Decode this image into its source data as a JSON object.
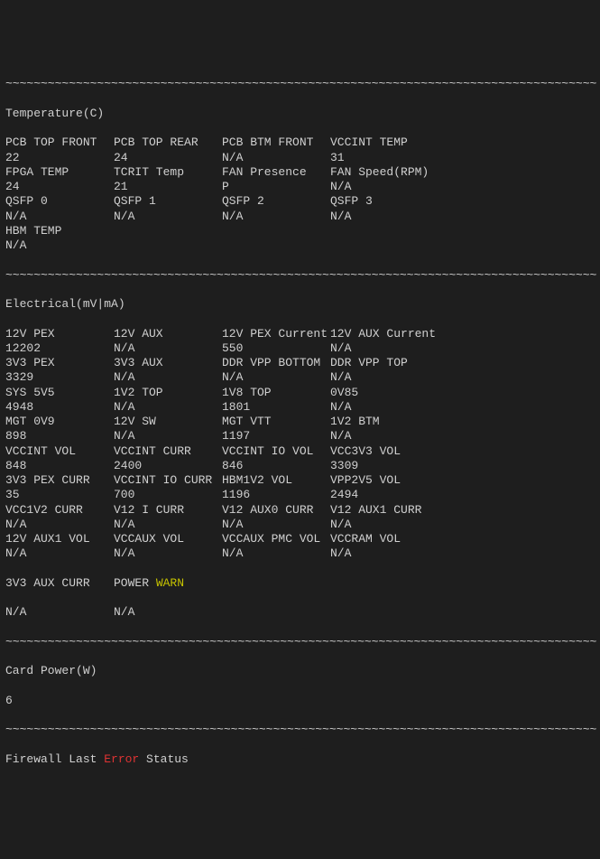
{
  "separator": "~~~~~~~~~~~~~~~~~~~~~~~~~~~~~~~~~~~~~~~~~~~~~~~~~~~~~~~~~~~~~~~~~~~~~~~~~~~~~~~~~~~~",
  "sections": {
    "temperature": {
      "title": "Temperature(C)",
      "rows": [
        [
          "PCB TOP FRONT",
          "PCB TOP REAR",
          "PCB BTM FRONT",
          "VCCINT TEMP"
        ],
        [
          "22",
          "24",
          "N/A",
          "31"
        ],
        [
          "FPGA TEMP",
          "TCRIT Temp",
          "FAN Presence",
          "FAN Speed(RPM)"
        ],
        [
          "24",
          "21",
          "P",
          "N/A"
        ],
        [
          "QSFP 0",
          "QSFP 1",
          "QSFP 2",
          "QSFP 3"
        ],
        [
          "N/A",
          "N/A",
          "N/A",
          "N/A"
        ],
        [
          "HBM TEMP",
          "",
          "",
          ""
        ],
        [
          "N/A",
          "",
          "",
          ""
        ]
      ]
    },
    "electrical": {
      "title": "Electrical(mV|mA)",
      "rows": [
        [
          "12V PEX",
          "12V AUX",
          "12V PEX Current",
          "12V AUX Current"
        ],
        [
          "12202",
          "N/A",
          "550",
          "N/A"
        ],
        [
          "3V3 PEX",
          "3V3 AUX",
          "DDR VPP BOTTOM",
          "DDR VPP TOP"
        ],
        [
          "3329",
          "N/A",
          "N/A",
          "N/A"
        ],
        [
          "SYS 5V5",
          "1V2 TOP",
          "1V8 TOP",
          "0V85"
        ],
        [
          "4948",
          "N/A",
          "1801",
          "N/A"
        ],
        [
          "MGT 0V9",
          "12V SW",
          "MGT VTT",
          "1V2 BTM"
        ],
        [
          "898",
          "N/A",
          "1197",
          "N/A"
        ],
        [
          "VCCINT VOL",
          "VCCINT CURR",
          "VCCINT IO VOL",
          "VCC3V3 VOL"
        ],
        [
          "848",
          "2400",
          "846",
          "3309"
        ],
        [
          "3V3 PEX CURR",
          "VCCINT IO CURR",
          "HBM1V2 VOL",
          "VPP2V5 VOL"
        ],
        [
          "35",
          "700",
          "1196",
          "2494"
        ],
        [
          "VCC1V2 CURR",
          "V12 I CURR",
          "V12 AUX0 CURR",
          "V12 AUX1 CURR"
        ],
        [
          "N/A",
          "N/A",
          "N/A",
          "N/A"
        ],
        [
          "12V AUX1 VOL",
          "VCCAUX VOL",
          "VCCAUX PMC VOL",
          "VCCRAM VOL"
        ],
        [
          "N/A",
          "N/A",
          "N/A",
          "N/A"
        ]
      ],
      "last_row_label1": "3V3 AUX CURR",
      "last_row_label2": "POWER ",
      "warn_text": "WARN",
      "last_row_val1": "N/A",
      "last_row_val2": "N/A"
    },
    "cardpower": {
      "title": "Card Power(W)",
      "value": "6"
    },
    "firewall": {
      "prefix": "Firewall Last ",
      "error_word": "Error",
      "suffix": " Status"
    }
  }
}
